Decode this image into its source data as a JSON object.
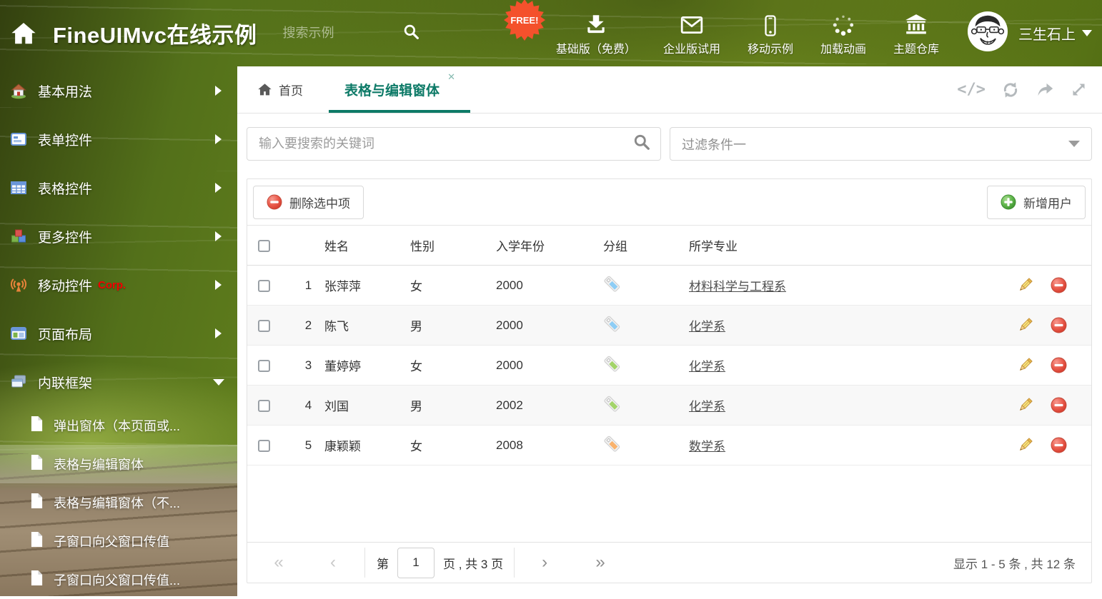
{
  "colors": {
    "accent": "#0d7a67",
    "delete_red": "#e15a4e",
    "add_green": "#58b457"
  },
  "header": {
    "title": "FineUIMvc在线示例",
    "search_placeholder": "搜索示例",
    "free_badge": "FREE!",
    "nav_items": [
      {
        "label": "基础版（免费）",
        "icon": "download-icon"
      },
      {
        "label": "企业版试用",
        "icon": "envelope-icon"
      },
      {
        "label": "移动示例",
        "icon": "phone-icon"
      },
      {
        "label": "加载动画",
        "icon": "spinner-icon"
      },
      {
        "label": "主题仓库",
        "icon": "bank-icon"
      }
    ],
    "username": "三生石上"
  },
  "sidebar": {
    "items": [
      {
        "label": "基本用法",
        "icon": "home-icon"
      },
      {
        "label": "表单控件",
        "icon": "form-icon"
      },
      {
        "label": "表格控件",
        "icon": "table-icon"
      },
      {
        "label": "更多控件",
        "icon": "cubes-icon"
      },
      {
        "label": "移动控件",
        "badge": "Corp.",
        "icon": "antenna-icon"
      },
      {
        "label": "页面布局",
        "icon": "layout-icon"
      },
      {
        "label": "内联框架",
        "icon": "frames-icon"
      }
    ],
    "subitems": [
      "弹出窗体（本页面或...",
      "表格与编辑窗体",
      "表格与编辑窗体（不...",
      "子窗口向父窗口传值",
      "子窗口向父窗口传值..."
    ]
  },
  "tabs": {
    "home_label": "首页",
    "active_label": "表格与编辑窗体",
    "close_glyph": "✕",
    "code_glyph": "</>"
  },
  "filters": {
    "search_placeholder": "输入要搜索的关键词",
    "filter_value": "过滤条件一"
  },
  "toolbar": {
    "delete_label": "删除选中项",
    "add_label": "新增用户"
  },
  "table": {
    "headers": {
      "name": "姓名",
      "gender": "性别",
      "year": "入学年份",
      "group": "分组",
      "major": "所学专业"
    },
    "rows": [
      {
        "num": "1",
        "name": "张萍萍",
        "gender": "女",
        "year": "2000",
        "tag_color": "#8ecdf5",
        "major": "材料科学与工程系"
      },
      {
        "num": "2",
        "name": "陈飞",
        "gender": "男",
        "year": "2000",
        "tag_color": "#8ecdf5",
        "major": "化学系"
      },
      {
        "num": "3",
        "name": "董婷婷",
        "gender": "女",
        "year": "2000",
        "tag_color": "#a3d469",
        "major": "化学系"
      },
      {
        "num": "4",
        "name": "刘国",
        "gender": "男",
        "year": "2002",
        "tag_color": "#a3d469",
        "major": "化学系"
      },
      {
        "num": "5",
        "name": "康颖颖",
        "gender": "女",
        "year": "2008",
        "tag_color": "#f9b26c",
        "major": "数学系"
      }
    ]
  },
  "pagination": {
    "first": "«",
    "prev": "‹",
    "page_prefix": "第",
    "page_value": "1",
    "page_suffix": "页 , 共 3 页",
    "next": "›",
    "last": "»",
    "summary": "显示 1 - 5 条 , 共 12 条"
  }
}
